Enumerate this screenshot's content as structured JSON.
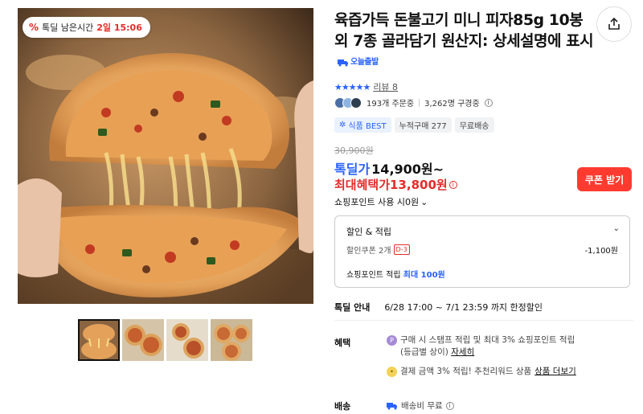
{
  "image": {
    "timer_badge": {
      "icon": "percent-tag-icon",
      "label": "톡딜 남은시간",
      "time": "2일 15:06"
    },
    "thumbnail_count": 4
  },
  "product": {
    "title": "육즙가득 돈불고기 미니 피자85g 10봉 외 7종 골라담기 원산지: 상세설명에 표시",
    "today_ship": "오늘출발",
    "rating_stars": "★★★★★",
    "review_label": "리뷰 8",
    "orders": "193개 주문중",
    "buyers": "3,262명 구경중",
    "badges": {
      "best": "식품 BEST",
      "cumulative": "누적구매 277",
      "free_ship": "무료배송"
    }
  },
  "price": {
    "original": "30,900원",
    "sale_label": "톡딜가",
    "sale_price": "14,900원~",
    "benefit": "최대혜택가13,800원",
    "coupon_button": "쿠폰 받기",
    "point_use": "쇼핑포인트 사용 시0원"
  },
  "discount": {
    "heading": "할인 & 적립",
    "coupon_label": "할인쿠폰 2개",
    "dday": "D-3",
    "coupon_amount": "-1,100원",
    "point_label": "쇼핑포인트 적립",
    "point_value": "최대 100원"
  },
  "deal": {
    "label": "톡딜 안내",
    "period": "6/28 17:00 ~ 7/1 23:59 까지 한정할인"
  },
  "perks": {
    "label": "혜택",
    "line1": "구매 시 스탬프 적립 및 최대 3% 쇼핑포인트 적립",
    "line1_sub": "(등급별 상이)",
    "line1_link": "자세히",
    "line2": "결제 금액 3% 적립! 추천리워드 상품",
    "line2_link": "상품 더보기"
  },
  "shipping": {
    "label": "배송",
    "value": "배송비 무료"
  },
  "colors": {
    "accent_blue": "#2962ff",
    "accent_red": "#e52b2b",
    "coupon_red": "#ff3b30"
  }
}
